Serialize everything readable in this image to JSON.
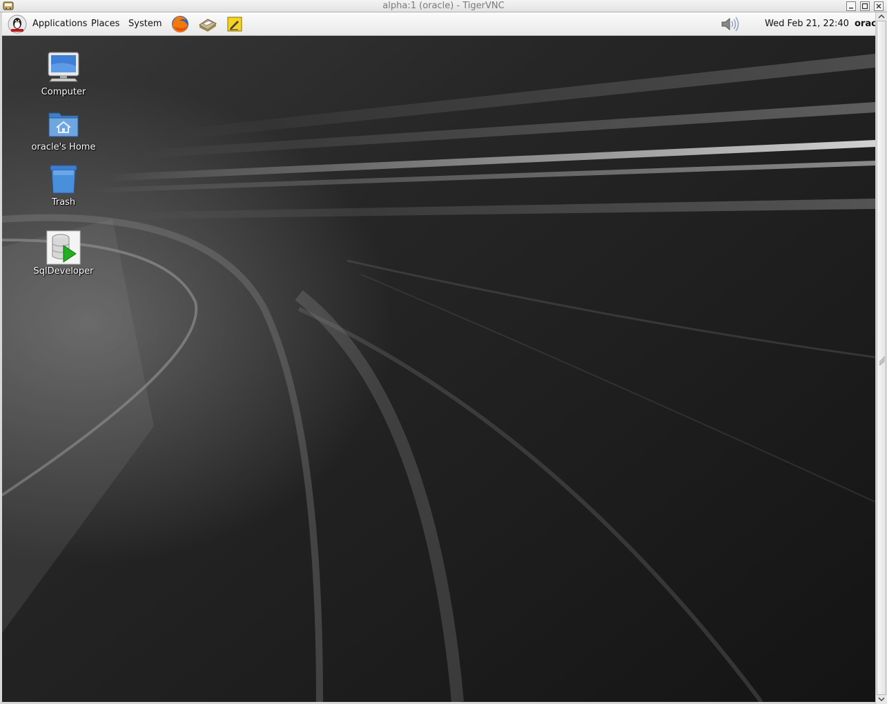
{
  "window": {
    "title": "alpha:1 (oracle) - TigerVNC",
    "controls": {
      "minimize": "minimize",
      "maximize": "maximize",
      "close": "close"
    }
  },
  "panel": {
    "menus": [
      "Applications",
      "Places",
      "System"
    ],
    "launchers": [
      "firefox-icon",
      "mail-icon",
      "notes-icon"
    ],
    "volume_icon": "speaker-icon",
    "clock": "Wed Feb 21, 22:40",
    "user": "oracle"
  },
  "desktop": {
    "icons": [
      {
        "label": "Computer",
        "icon": "computer-icon"
      },
      {
        "label": "oracle's Home",
        "icon": "home-folder-icon"
      },
      {
        "label": "Trash",
        "icon": "trash-icon"
      },
      {
        "label": "SqlDeveloper",
        "icon": "sqldeveloper-icon"
      }
    ]
  },
  "colors": {
    "panel_bg": "#f2f2f2",
    "wallpaper_dark": "#1c1c1c",
    "wallpaper_light": "#9a9a9a",
    "folder_blue": "#4a8fd4",
    "launch_green": "#22b022"
  }
}
